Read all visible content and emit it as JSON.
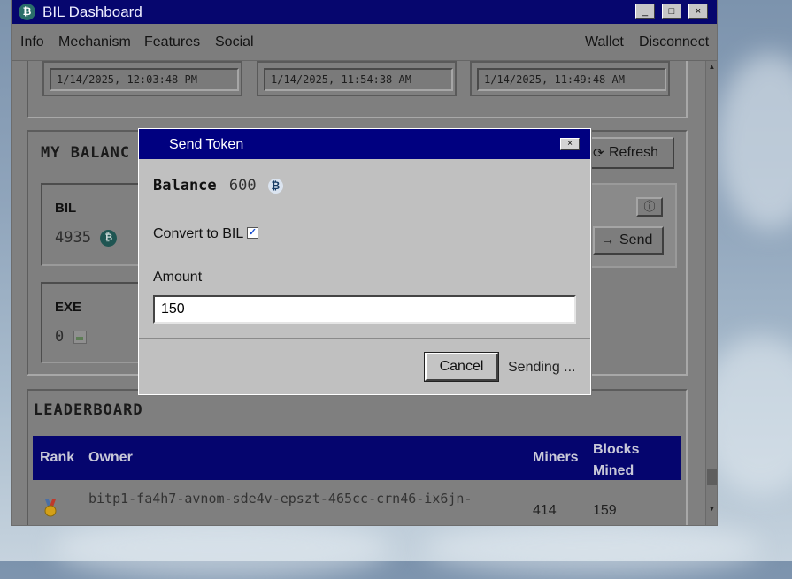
{
  "window": {
    "title": "BIL Dashboard",
    "app_icon_glyph": "₿",
    "controls": [
      "_",
      "□",
      "×"
    ]
  },
  "menu": {
    "left": [
      "Info",
      "Mechanism",
      "Features",
      "Social"
    ],
    "right": [
      "Wallet",
      "Disconnect"
    ]
  },
  "timestamps": [
    "1/14/2025, 12:03:48 PM",
    "1/14/2025, 11:54:38 AM",
    "1/14/2025, 11:49:48 AM"
  ],
  "balances": {
    "title": "MY BALANC",
    "refresh_label": "Refresh",
    "refresh_icon": "refresh-icon",
    "tokens": [
      {
        "name": "BIL",
        "amount": "4935",
        "icon": "bil-coin-icon",
        "glyph": "₿"
      },
      {
        "name": "EXE",
        "amount": "0",
        "icon": "broken-image-icon"
      }
    ],
    "info_button_glyph": "ⓘ",
    "send_label": "Send",
    "send_icon": "arrow-right-icon"
  },
  "leaderboard": {
    "title": "LEADERBOARD",
    "columns": {
      "rank": "Rank",
      "owner": "Owner",
      "miners": "Miners",
      "blocks_line1": "Blocks",
      "blocks_line2": "Mined"
    },
    "rows": [
      {
        "rank_icon": "medal-icon",
        "owner": "bitp1-fa4h7-avnom-sde4v-epszt-465cc-crn46-ix6jn-",
        "miners": "414",
        "blocks": "159"
      }
    ]
  },
  "dialog": {
    "title": "Send Token",
    "close_glyph": "×",
    "balance_label": "Balance",
    "balance_value": "600",
    "balance_coin_glyph": "₿",
    "convert_label": "Convert to BIL",
    "convert_checked": true,
    "check_glyph": "✓",
    "amount_label": "Amount",
    "amount_value": "150",
    "cancel_label": "Cancel",
    "status_text": "Sending ..."
  },
  "colors": {
    "titlebar": "#06066e",
    "dialog_titlebar": "#000080",
    "window_bg": "#808080",
    "dialog_bg": "#c0c0c0"
  }
}
